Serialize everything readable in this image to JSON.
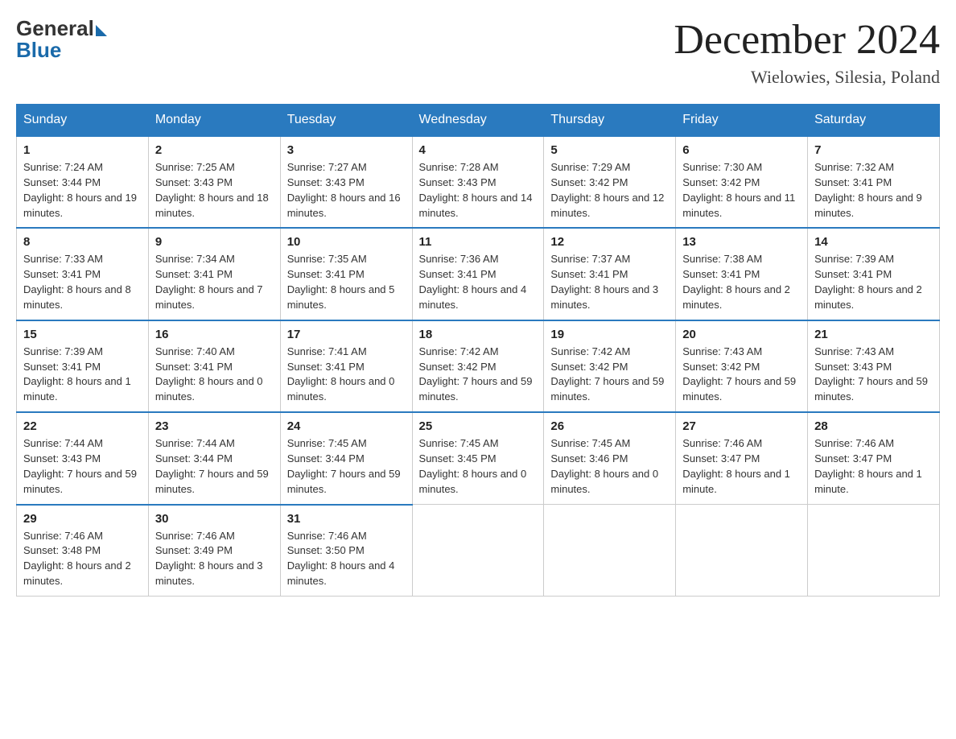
{
  "logo": {
    "general": "General",
    "blue": "Blue"
  },
  "title": "December 2024",
  "location": "Wielowies, Silesia, Poland",
  "days_of_week": [
    "Sunday",
    "Monday",
    "Tuesday",
    "Wednesday",
    "Thursday",
    "Friday",
    "Saturday"
  ],
  "weeks": [
    [
      {
        "day": "1",
        "sunrise": "7:24 AM",
        "sunset": "3:44 PM",
        "daylight": "8 hours and 19 minutes."
      },
      {
        "day": "2",
        "sunrise": "7:25 AM",
        "sunset": "3:43 PM",
        "daylight": "8 hours and 18 minutes."
      },
      {
        "day": "3",
        "sunrise": "7:27 AM",
        "sunset": "3:43 PM",
        "daylight": "8 hours and 16 minutes."
      },
      {
        "day": "4",
        "sunrise": "7:28 AM",
        "sunset": "3:43 PM",
        "daylight": "8 hours and 14 minutes."
      },
      {
        "day": "5",
        "sunrise": "7:29 AM",
        "sunset": "3:42 PM",
        "daylight": "8 hours and 12 minutes."
      },
      {
        "day": "6",
        "sunrise": "7:30 AM",
        "sunset": "3:42 PM",
        "daylight": "8 hours and 11 minutes."
      },
      {
        "day": "7",
        "sunrise": "7:32 AM",
        "sunset": "3:41 PM",
        "daylight": "8 hours and 9 minutes."
      }
    ],
    [
      {
        "day": "8",
        "sunrise": "7:33 AM",
        "sunset": "3:41 PM",
        "daylight": "8 hours and 8 minutes."
      },
      {
        "day": "9",
        "sunrise": "7:34 AM",
        "sunset": "3:41 PM",
        "daylight": "8 hours and 7 minutes."
      },
      {
        "day": "10",
        "sunrise": "7:35 AM",
        "sunset": "3:41 PM",
        "daylight": "8 hours and 5 minutes."
      },
      {
        "day": "11",
        "sunrise": "7:36 AM",
        "sunset": "3:41 PM",
        "daylight": "8 hours and 4 minutes."
      },
      {
        "day": "12",
        "sunrise": "7:37 AM",
        "sunset": "3:41 PM",
        "daylight": "8 hours and 3 minutes."
      },
      {
        "day": "13",
        "sunrise": "7:38 AM",
        "sunset": "3:41 PM",
        "daylight": "8 hours and 2 minutes."
      },
      {
        "day": "14",
        "sunrise": "7:39 AM",
        "sunset": "3:41 PM",
        "daylight": "8 hours and 2 minutes."
      }
    ],
    [
      {
        "day": "15",
        "sunrise": "7:39 AM",
        "sunset": "3:41 PM",
        "daylight": "8 hours and 1 minute."
      },
      {
        "day": "16",
        "sunrise": "7:40 AM",
        "sunset": "3:41 PM",
        "daylight": "8 hours and 0 minutes."
      },
      {
        "day": "17",
        "sunrise": "7:41 AM",
        "sunset": "3:41 PM",
        "daylight": "8 hours and 0 minutes."
      },
      {
        "day": "18",
        "sunrise": "7:42 AM",
        "sunset": "3:42 PM",
        "daylight": "7 hours and 59 minutes."
      },
      {
        "day": "19",
        "sunrise": "7:42 AM",
        "sunset": "3:42 PM",
        "daylight": "7 hours and 59 minutes."
      },
      {
        "day": "20",
        "sunrise": "7:43 AM",
        "sunset": "3:42 PM",
        "daylight": "7 hours and 59 minutes."
      },
      {
        "day": "21",
        "sunrise": "7:43 AM",
        "sunset": "3:43 PM",
        "daylight": "7 hours and 59 minutes."
      }
    ],
    [
      {
        "day": "22",
        "sunrise": "7:44 AM",
        "sunset": "3:43 PM",
        "daylight": "7 hours and 59 minutes."
      },
      {
        "day": "23",
        "sunrise": "7:44 AM",
        "sunset": "3:44 PM",
        "daylight": "7 hours and 59 minutes."
      },
      {
        "day": "24",
        "sunrise": "7:45 AM",
        "sunset": "3:44 PM",
        "daylight": "7 hours and 59 minutes."
      },
      {
        "day": "25",
        "sunrise": "7:45 AM",
        "sunset": "3:45 PM",
        "daylight": "8 hours and 0 minutes."
      },
      {
        "day": "26",
        "sunrise": "7:45 AM",
        "sunset": "3:46 PM",
        "daylight": "8 hours and 0 minutes."
      },
      {
        "day": "27",
        "sunrise": "7:46 AM",
        "sunset": "3:47 PM",
        "daylight": "8 hours and 1 minute."
      },
      {
        "day": "28",
        "sunrise": "7:46 AM",
        "sunset": "3:47 PM",
        "daylight": "8 hours and 1 minute."
      }
    ],
    [
      {
        "day": "29",
        "sunrise": "7:46 AM",
        "sunset": "3:48 PM",
        "daylight": "8 hours and 2 minutes."
      },
      {
        "day": "30",
        "sunrise": "7:46 AM",
        "sunset": "3:49 PM",
        "daylight": "8 hours and 3 minutes."
      },
      {
        "day": "31",
        "sunrise": "7:46 AM",
        "sunset": "3:50 PM",
        "daylight": "8 hours and 4 minutes."
      },
      null,
      null,
      null,
      null
    ]
  ]
}
